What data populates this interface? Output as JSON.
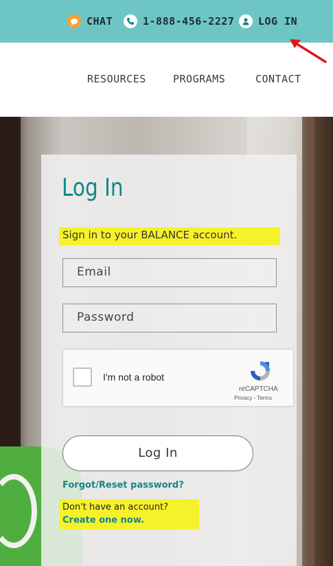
{
  "topbar": {
    "chat_label": "CHAT",
    "phone": "1-888-456-2227",
    "login_label": "LOG IN",
    "colors": {
      "bar": "#6ec6c4",
      "chat_icon": "#f4a136"
    },
    "icons": [
      "chat-bubble-icon",
      "phone-icon",
      "user-icon"
    ]
  },
  "nav": {
    "items": [
      "RESOURCES",
      "PROGRAMS",
      "CONTACT"
    ]
  },
  "login_form": {
    "title": "Log In",
    "subtitle": "Sign in to your BALANCE account.",
    "email_placeholder": "Email",
    "password_placeholder": "Password",
    "recaptcha": {
      "label": "I'm not a robot",
      "brand": "reCAPTCHA",
      "links": "Privacy - Terms"
    },
    "submit_label": "Log In",
    "forgot_link": "Forgot/Reset password?",
    "no_account_text": "Don't have an account?",
    "create_link": "Create one now.",
    "colors": {
      "accent": "#138686",
      "highlight": "#f6f22a"
    }
  },
  "annotation": {
    "arrow_color": "#e0161b"
  }
}
